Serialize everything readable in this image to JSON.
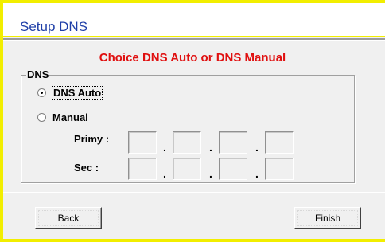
{
  "window": {
    "title": "Setup DNS",
    "subtitle": "Choice DNS Auto or DNS Manual"
  },
  "dns_group": {
    "label": "DNS",
    "options": [
      {
        "label": "DNS Auto",
        "selected": true
      },
      {
        "label": "Manual",
        "selected": false
      }
    ],
    "primary": {
      "label": "Primy :",
      "octets": [
        "",
        "",
        "",
        ""
      ]
    },
    "secondary": {
      "label": "Sec :",
      "octets": [
        "",
        "",
        "",
        ""
      ]
    },
    "separator": "."
  },
  "buttons": {
    "back": "Back",
    "finish": "Finish"
  },
  "colors": {
    "border_accent": "#f2ee00",
    "title": "#1f3fa8",
    "subtitle": "#e01010"
  }
}
